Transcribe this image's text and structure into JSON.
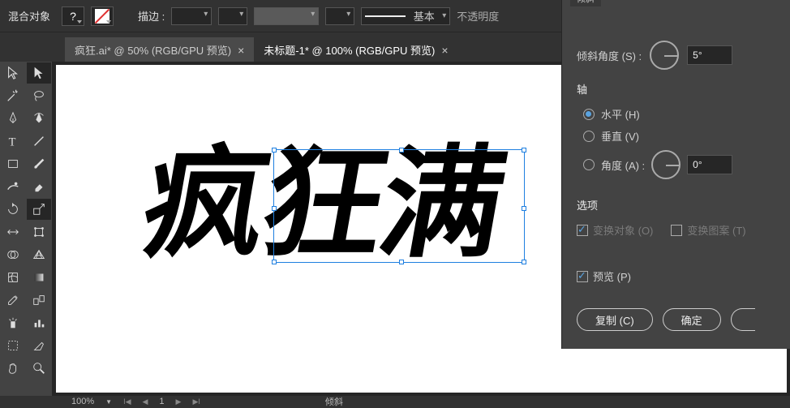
{
  "optionsBar": {
    "blend": "混合对象",
    "stroke": "描边 :",
    "basic": "基本",
    "opacity": "不透明度"
  },
  "tabs": [
    {
      "label": "疯狂.ai* @ 50% (RGB/GPU 预览)"
    },
    {
      "label": "未标题-1* @ 100% (RGB/GPU 预览)"
    }
  ],
  "statusBar": {
    "zoom": "100%",
    "page": "1",
    "mode": "倾斜"
  },
  "panel": {
    "title": "倾斜",
    "angle_label": "倾斜角度 (S) :",
    "angle_value": "5°",
    "axis_title": "轴",
    "radio_h": "水平 (H)",
    "radio_v": "垂直 (V)",
    "radio_angle": "角度 (A) :",
    "angle_axis_value": "0°",
    "options_title": "选项",
    "transform_obj": "变换对象 (O)",
    "transform_pat": "变换图案 (T)",
    "preview": "预览 (P)",
    "copy_btn": "复制 (C)",
    "ok_btn": "确定"
  }
}
